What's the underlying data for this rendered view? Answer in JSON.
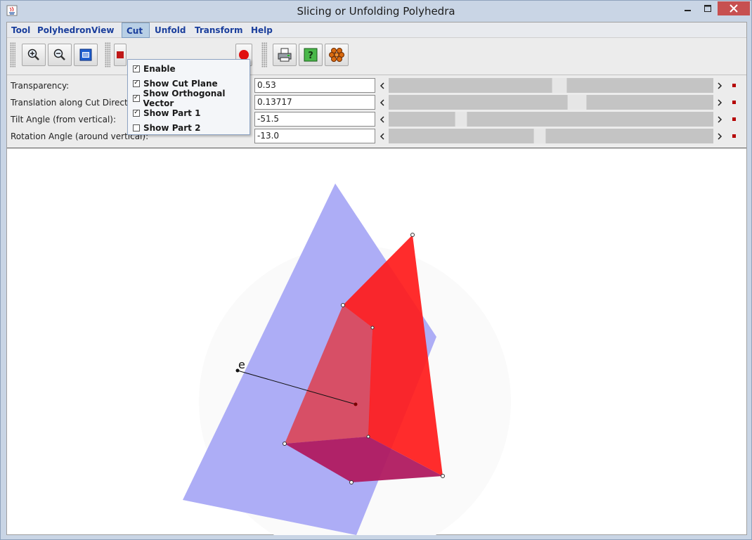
{
  "window": {
    "title": "Slicing or Unfolding Polyhedra",
    "close_color": "#c75050"
  },
  "menubar": {
    "items": [
      "Tool",
      "Polyhedron",
      "View",
      "Cut",
      "Unfold",
      "Transform",
      "Help"
    ],
    "active": "Cut"
  },
  "toolbar": {
    "icons": [
      "zoom-in-icon",
      "zoom-out-icon",
      "fit-view-icon",
      "print-icon",
      "help-icon",
      "molecule-icon"
    ]
  },
  "cut_menu": {
    "items": [
      {
        "label": "Enable",
        "checked": true
      },
      {
        "label": "Show Cut Plane",
        "checked": true
      },
      {
        "label": "Show Orthogonal Vector",
        "checked": true
      },
      {
        "label": "Show Part 1",
        "checked": true
      },
      {
        "label": "Show Part 2",
        "checked": false
      }
    ]
  },
  "params": [
    {
      "label": "Transparency:",
      "value": "0.53"
    },
    {
      "label": "Translation along Cut Direction:",
      "value": "0.13717"
    },
    {
      "label": "Tilt Angle (from vertical):",
      "value": "-51.5"
    },
    {
      "label": "Rotation Angle (around vertical):",
      "value": "-13.0"
    }
  ],
  "viewport": {
    "vector_label": "e",
    "plane_color": "#a9a9f5",
    "polyhedron_color": "#ff1a1a",
    "marker_color": "#b50000"
  }
}
